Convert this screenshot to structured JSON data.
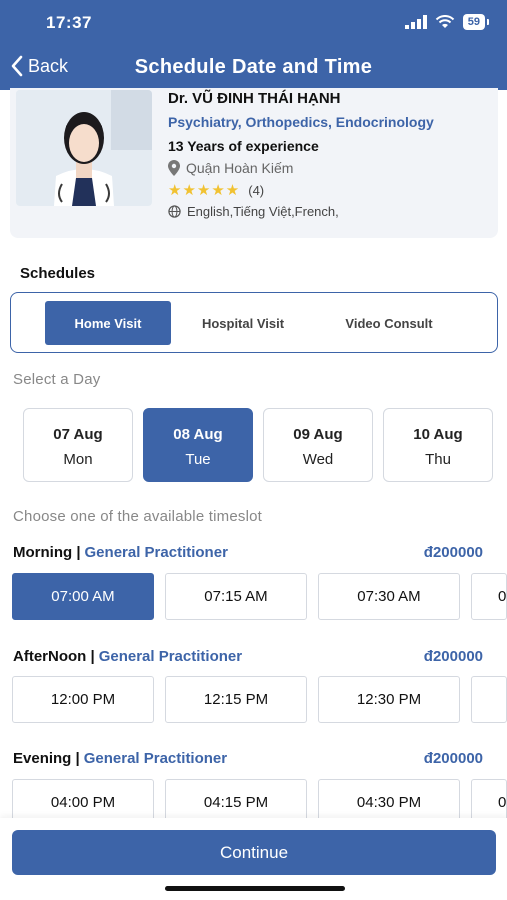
{
  "status_bar": {
    "time": "17:37",
    "battery": "59"
  },
  "nav": {
    "back_label": "Back",
    "title": "Schedule Date and Time"
  },
  "doctor": {
    "name": "Dr. VŨ ĐINH THÁI HẠNH",
    "specialties": "Psychiatry, Orthopedics, Endocrinology",
    "experience": "13 Years of experience",
    "location": "Quận Hoàn Kiếm",
    "stars": "★★★★★",
    "rating_count": "(4)",
    "rating_value": 5,
    "languages": "English,Tiếng Việt,French,"
  },
  "schedules": {
    "title": "Schedules",
    "tabs": [
      {
        "label": "Home Visit",
        "active": true
      },
      {
        "label": "Hospital Visit",
        "active": false
      },
      {
        "label": "Video Consult",
        "active": false
      }
    ]
  },
  "day_select": {
    "label": "Select a Day",
    "days": [
      {
        "date": "07 Aug",
        "weekday": "Mon"
      },
      {
        "date": "08 Aug",
        "weekday": "Tue",
        "active": true
      },
      {
        "date": "09 Aug",
        "weekday": "Wed"
      },
      {
        "date": "10 Aug",
        "weekday": "Thu"
      }
    ]
  },
  "timeslot_label": "Choose one of the available timeslot",
  "periods": [
    {
      "name": "Morning |",
      "specialty": "General Practitioner",
      "price": "đ200000",
      "slots": [
        "07:00 AM",
        "07:15 AM",
        "07:30 AM",
        "0"
      ]
    },
    {
      "name": "AfterNoon |",
      "specialty": "General Practitioner",
      "price": "đ200000",
      "slots": [
        "12:00 PM",
        "12:15 PM",
        "12:30 PM",
        ""
      ]
    },
    {
      "name": "Evening |",
      "specialty": "General Practitioner",
      "price": "đ200000",
      "slots": [
        "04:00 PM",
        "04:15 PM",
        "04:30 PM",
        "0"
      ]
    }
  ],
  "continue_label": "Continue",
  "colors": {
    "primary": "#3d64a8",
    "star": "#f1c232"
  }
}
